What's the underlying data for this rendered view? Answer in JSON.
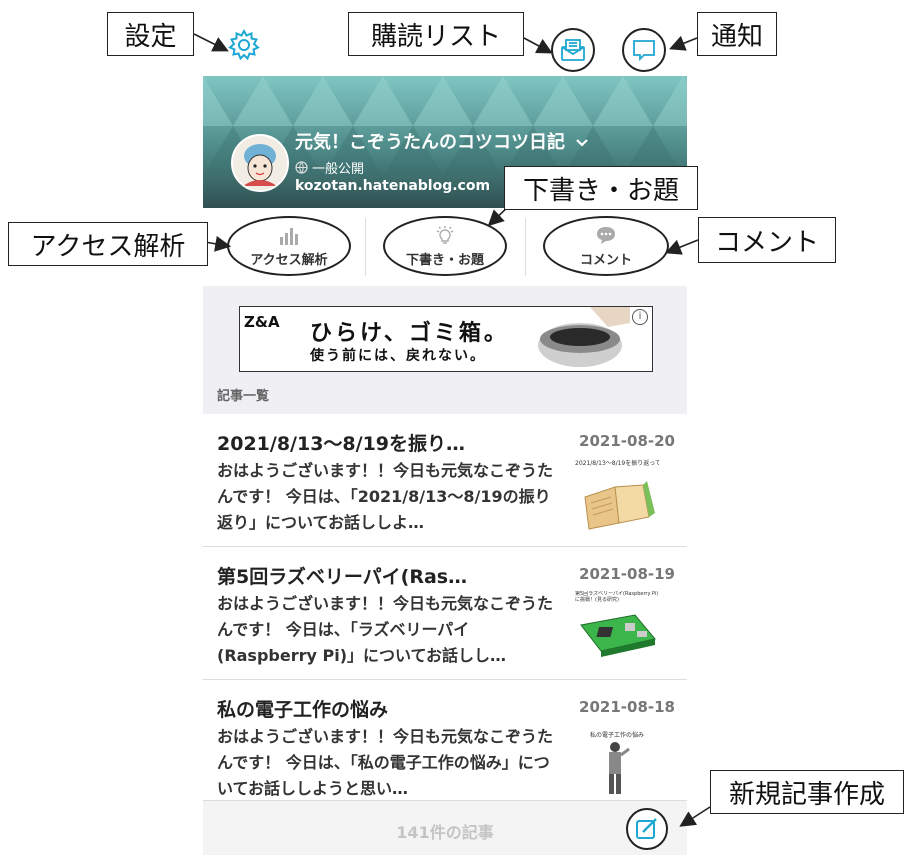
{
  "topbar": {
    "settings_icon": "gear-icon",
    "reading_list_icon": "envelope-icon",
    "notifications_icon": "speech-bubble-icon"
  },
  "blog": {
    "title": "元気！こぞうたんのコツコツ日記",
    "visibility": "一般公開",
    "url": "kozotan.hatenablog.com"
  },
  "actions": [
    {
      "label": "アクセス解析",
      "icon": "bar-chart-icon"
    },
    {
      "label": "下書き・お題",
      "icon": "lightbulb-icon"
    },
    {
      "label": "コメント",
      "icon": "chat-icon"
    }
  ],
  "ad": {
    "logo": "Z&A",
    "line1": "ひらけ、ゴミ箱。",
    "line2": "使う前には、戻れない。"
  },
  "section_label": "記事一覧",
  "articles": [
    {
      "title": "2021/8/13〜8/19を振り…",
      "date": "2021-08-20",
      "snippet": "おはようございます！！今日も元気なこぞうたんです！ 今日は、「2021/8/13〜8/19の振り返り」についてお話ししよ…",
      "thumb_caption": "2021/8/13〜8/19を振り返ってみて"
    },
    {
      "title": "第5回ラズベリーパイ(Ras…",
      "date": "2021-08-19",
      "snippet": "おはようございます！！今日も元気なこぞうたんです！ 今日は、「ラズベリーパイ(Raspberry Pi)」についてお話しし…",
      "thumb_caption": "第5回ラズベリーパイ(Raspberry Pi)に挑戦！(見る研究)"
    },
    {
      "title": "私の電子工作の悩み",
      "date": "2021-08-18",
      "snippet": "おはようございます！！今日も元気なこぞうたんです！ 今日は、「私の電子工作の悩み」についてお話ししようと思い…",
      "thumb_caption": "私の電子工作の悩み"
    }
  ],
  "bottombar": {
    "count": "141件の記事",
    "compose_icon": "compose-icon"
  },
  "callouts": {
    "settings": "設定",
    "reading_list": "購読リスト",
    "notifications": "通知",
    "drafts": "下書き・お題",
    "access": "アクセス解析",
    "comments": "コメント",
    "new_post": "新規記事作成"
  },
  "colors": {
    "accent": "#1ea7d2",
    "hero_top": "#7fc6c3",
    "hero_bottom": "#2f4f50"
  }
}
